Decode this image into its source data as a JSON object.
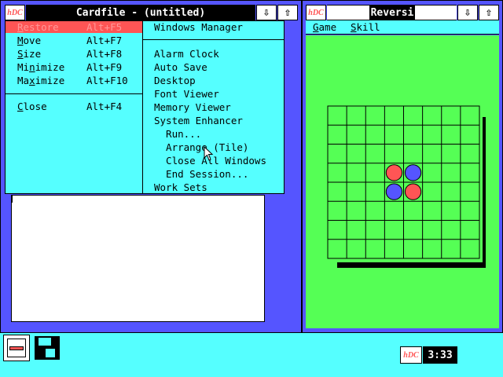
{
  "cardfile": {
    "logo": "hDC",
    "title": "Cardfile - (untitled)",
    "btn_minimize": "⇩",
    "btn_maximize": "⇧"
  },
  "system_menu": {
    "items": [
      {
        "label_pre": "",
        "label_ul": "R",
        "label_post": "estore",
        "shortcut": "Alt+F5",
        "highlighted": true
      },
      {
        "label_pre": "",
        "label_ul": "M",
        "label_post": "ove",
        "shortcut": "Alt+F7"
      },
      {
        "label_pre": "",
        "label_ul": "S",
        "label_post": "ize",
        "shortcut": "Alt+F8"
      },
      {
        "label_pre": "Mi",
        "label_ul": "n",
        "label_post": "imize",
        "shortcut": "Alt+F9"
      },
      {
        "label_pre": "Ma",
        "label_ul": "x",
        "label_post": "imize",
        "shortcut": "Alt+F10"
      },
      {
        "label_pre": "",
        "label_ul": "C",
        "label_post": "lose",
        "shortcut": "Alt+F4"
      }
    ]
  },
  "hdc_menu": {
    "items": [
      "Windows Manager",
      "Alarm Clock",
      "Auto Save",
      "Desktop",
      "Font Viewer",
      "Memory Viewer",
      "System Enhancer",
      "  Run...",
      "  Arrange (Tile)",
      "  Close All Windows",
      "  End Session...",
      "Work Sets"
    ]
  },
  "reversi": {
    "logo": "hDC",
    "title": "Reversi",
    "btn_minimize": "⇩",
    "btn_maximize": "⇧",
    "menu_game_ul": "G",
    "menu_game_rest": "ame",
    "menu_skill_ul": "S",
    "menu_skill_rest": "kill",
    "board_size": 8,
    "pieces": [
      {
        "row": 3,
        "col": 3,
        "color": "red"
      },
      {
        "row": 3,
        "col": 4,
        "color": "blue"
      },
      {
        "row": 4,
        "col": 3,
        "color": "blue"
      },
      {
        "row": 4,
        "col": 4,
        "color": "red"
      }
    ],
    "colors": {
      "red": "#ff5555",
      "blue": "#5555ff",
      "board": "#55ff55"
    }
  },
  "taskbar": {
    "logo": "hDC",
    "clock": "3:33"
  }
}
